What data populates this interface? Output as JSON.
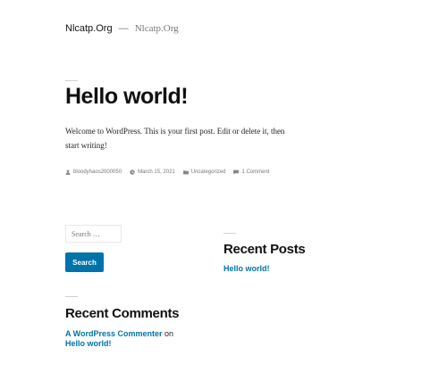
{
  "header": {
    "site_title": "Nlcatp.Org",
    "separator": "—",
    "site_description": "Nlcatp.Org"
  },
  "post": {
    "title": "Hello world!",
    "content": "Welcome to WordPress. This is your first post. Edit or delete it, then start writing!",
    "meta": {
      "author": "bloodyhaos2000050",
      "date": "March 15, 2021",
      "category": "Uncategorized",
      "comments": "1 Comment"
    }
  },
  "search": {
    "placeholder": "Search …",
    "button_label": "Search"
  },
  "recent_posts": {
    "title": "Recent Posts",
    "items": [
      "Hello world!"
    ]
  },
  "recent_comments": {
    "title": "Recent Comments",
    "commenter": "A WordPress Commenter",
    "connector": "on",
    "post": "Hello world!"
  },
  "colors": {
    "link": "#0073aa",
    "button_bg": "#0073aa",
    "muted": "#777777"
  }
}
